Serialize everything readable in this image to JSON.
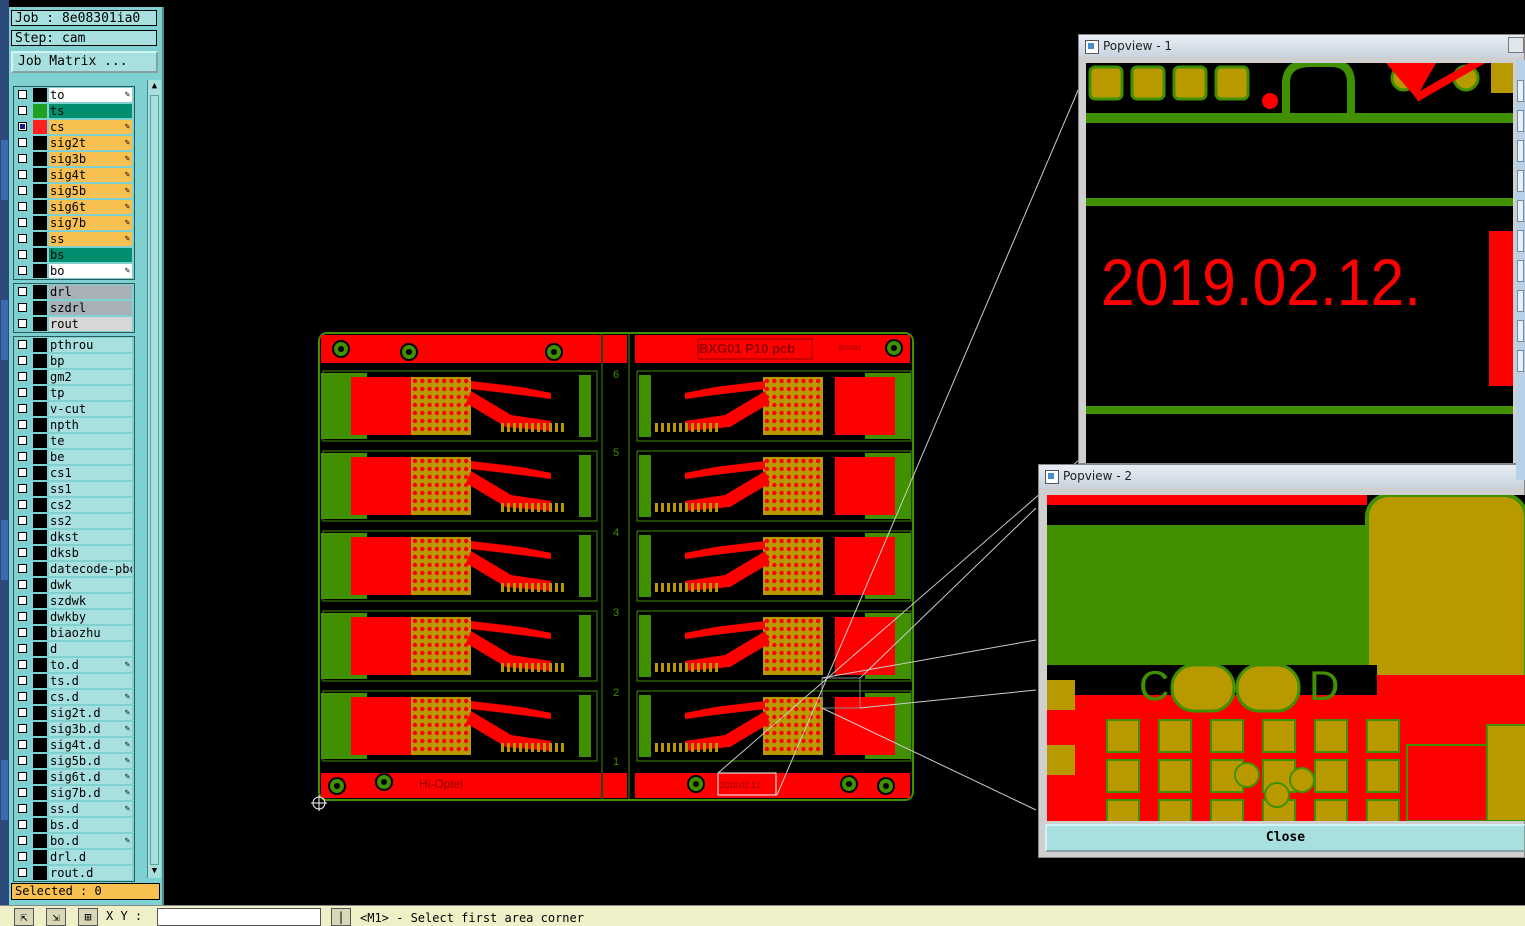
{
  "job_label": "Job : 8e08301ia0",
  "step_label": "Step: cam",
  "job_matrix_button": "Job Matrix ...",
  "layer_groups": [
    [
      {
        "name": "to",
        "color": "#ffffff",
        "swatch": "#000000",
        "checked": false,
        "signal": true
      },
      {
        "name": "ts",
        "color": "#009070",
        "swatch": "#20a020",
        "checked": false,
        "signal": false
      },
      {
        "name": "cs",
        "color": "#f8c050",
        "swatch": "#ff2020",
        "checked": true,
        "signal": true
      },
      {
        "name": "sig2t",
        "color": "#f8c050",
        "swatch": "#000000",
        "checked": false,
        "signal": true
      },
      {
        "name": "sig3b",
        "color": "#f8c050",
        "swatch": "#000000",
        "checked": false,
        "signal": true
      },
      {
        "name": "sig4t",
        "color": "#f8c050",
        "swatch": "#000000",
        "checked": false,
        "signal": true
      },
      {
        "name": "sig5b",
        "color": "#f8c050",
        "swatch": "#000000",
        "checked": false,
        "signal": true
      },
      {
        "name": "sig6t",
        "color": "#f8c050",
        "swatch": "#000000",
        "checked": false,
        "signal": true
      },
      {
        "name": "sig7b",
        "color": "#f8c050",
        "swatch": "#000000",
        "checked": false,
        "signal": true
      },
      {
        "name": "ss",
        "color": "#f8c050",
        "swatch": "#000000",
        "checked": false,
        "signal": true
      },
      {
        "name": "bs",
        "color": "#009070",
        "swatch": "#000000",
        "checked": false,
        "signal": false
      },
      {
        "name": "bo",
        "color": "#ffffff",
        "swatch": "#000000",
        "checked": false,
        "signal": true
      }
    ],
    [
      {
        "name": "drl",
        "color": "#a8b0b8",
        "swatch": "#000000",
        "checked": false,
        "signal": false
      },
      {
        "name": "szdrl",
        "color": "#a8b0b8",
        "swatch": "#000000",
        "checked": false,
        "signal": false
      },
      {
        "name": "rout",
        "color": "#d8d8d8",
        "swatch": "#000000",
        "checked": false,
        "signal": false
      }
    ],
    [
      {
        "name": "pthrou",
        "color": "#a8e0e0",
        "swatch": "#000000",
        "checked": false,
        "signal": false
      },
      {
        "name": "bp",
        "color": "#a8e0e0",
        "swatch": "#000000",
        "checked": false,
        "signal": false
      },
      {
        "name": "gm2",
        "color": "#a8e0e0",
        "swatch": "#000000",
        "checked": false,
        "signal": false
      },
      {
        "name": "tp",
        "color": "#a8e0e0",
        "swatch": "#000000",
        "checked": false,
        "signal": false
      },
      {
        "name": "v-cut",
        "color": "#a8e0e0",
        "swatch": "#000000",
        "checked": false,
        "signal": false
      },
      {
        "name": "npth",
        "color": "#a8e0e0",
        "swatch": "#000000",
        "checked": false,
        "signal": false
      },
      {
        "name": "te",
        "color": "#a8e0e0",
        "swatch": "#000000",
        "checked": false,
        "signal": false
      },
      {
        "name": "be",
        "color": "#a8e0e0",
        "swatch": "#000000",
        "checked": false,
        "signal": false
      },
      {
        "name": "cs1",
        "color": "#a8e0e0",
        "swatch": "#000000",
        "checked": false,
        "signal": false
      },
      {
        "name": "ss1",
        "color": "#a8e0e0",
        "swatch": "#000000",
        "checked": false,
        "signal": false
      },
      {
        "name": "cs2",
        "color": "#a8e0e0",
        "swatch": "#000000",
        "checked": false,
        "signal": false
      },
      {
        "name": "ss2",
        "color": "#a8e0e0",
        "swatch": "#000000",
        "checked": false,
        "signal": false
      },
      {
        "name": "dkst",
        "color": "#a8e0e0",
        "swatch": "#000000",
        "checked": false,
        "signal": false
      },
      {
        "name": "dksb",
        "color": "#a8e0e0",
        "swatch": "#000000",
        "checked": false,
        "signal": false
      },
      {
        "name": "datecode-pbo",
        "color": "#a8e0e0",
        "swatch": "#000000",
        "checked": false,
        "signal": false
      },
      {
        "name": "dwk",
        "color": "#a8e0e0",
        "swatch": "#000000",
        "checked": false,
        "signal": false
      },
      {
        "name": "szdwk",
        "color": "#a8e0e0",
        "swatch": "#000000",
        "checked": false,
        "signal": false
      },
      {
        "name": "dwkby",
        "color": "#a8e0e0",
        "swatch": "#000000",
        "checked": false,
        "signal": false
      },
      {
        "name": "biaozhu",
        "color": "#a8e0e0",
        "swatch": "#000000",
        "checked": false,
        "signal": false
      },
      {
        "name": "d",
        "color": "#a8e0e0",
        "swatch": "#000000",
        "checked": false,
        "signal": false
      },
      {
        "name": "to.d",
        "color": "#a8e0e0",
        "swatch": "#000000",
        "checked": false,
        "signal": true
      },
      {
        "name": "ts.d",
        "color": "#a8e0e0",
        "swatch": "#000000",
        "checked": false,
        "signal": false
      },
      {
        "name": "cs.d",
        "color": "#a8e0e0",
        "swatch": "#000000",
        "checked": false,
        "signal": true
      },
      {
        "name": "sig2t.d",
        "color": "#a8e0e0",
        "swatch": "#000000",
        "checked": false,
        "signal": true
      },
      {
        "name": "sig3b.d",
        "color": "#a8e0e0",
        "swatch": "#000000",
        "checked": false,
        "signal": true
      },
      {
        "name": "sig4t.d",
        "color": "#a8e0e0",
        "swatch": "#000000",
        "checked": false,
        "signal": true
      },
      {
        "name": "sig5b.d",
        "color": "#a8e0e0",
        "swatch": "#000000",
        "checked": false,
        "signal": true
      },
      {
        "name": "sig6t.d",
        "color": "#a8e0e0",
        "swatch": "#000000",
        "checked": false,
        "signal": true
      },
      {
        "name": "sig7b.d",
        "color": "#a8e0e0",
        "swatch": "#000000",
        "checked": false,
        "signal": true
      },
      {
        "name": "ss.d",
        "color": "#a8e0e0",
        "swatch": "#000000",
        "checked": false,
        "signal": true
      },
      {
        "name": "bs.d",
        "color": "#a8e0e0",
        "swatch": "#000000",
        "checked": false,
        "signal": false
      },
      {
        "name": "bo.d",
        "color": "#a8e0e0",
        "swatch": "#000000",
        "checked": false,
        "signal": true
      },
      {
        "name": "drl.d",
        "color": "#a8e0e0",
        "swatch": "#000000",
        "checked": false,
        "signal": false
      },
      {
        "name": "rout.d",
        "color": "#a8e0e0",
        "swatch": "#000000",
        "checked": false,
        "signal": false
      }
    ]
  ],
  "selected_label": "Selected : 0",
  "bottom": {
    "xy_label": "X Y :",
    "xy_value": "",
    "prompt": "<M1> - Select first area corner"
  },
  "board": {
    "title": "BXG01 P10 pcb",
    "small_id": "BXG01",
    "brand": "Hi-Optel",
    "date_code": "2019.02.12",
    "column_numbers": [
      "6",
      "5",
      "4",
      "3",
      "2",
      "1"
    ]
  },
  "popview1": {
    "title": "Popview - 1",
    "date_text": "2019.02.12."
  },
  "popview2": {
    "title": "Popview - 2",
    "pad_labels": [
      "C",
      "D"
    ],
    "close_label": "Close"
  },
  "colors": {
    "copper_red": "#ff0000",
    "mask_green": "#409000",
    "pad_gold": "#b89a00",
    "panel_cyan": "#7fd0d0"
  }
}
